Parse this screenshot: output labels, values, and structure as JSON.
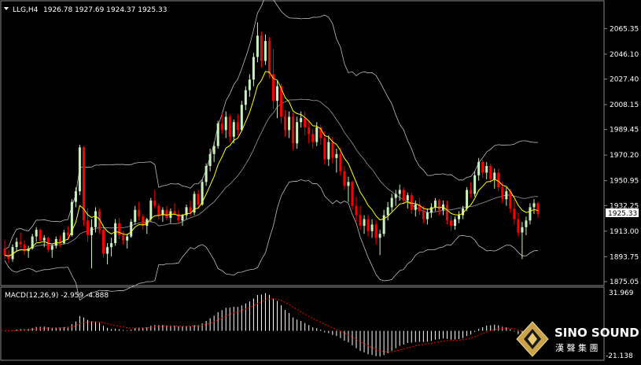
{
  "header": {
    "symbol": "LLG,H4",
    "ohlc": "1926.78 1927.69 1924.37 1925.33"
  },
  "macd_header": "MACD(12,26,9) -2.959 -4.888",
  "price_axis": {
    "ticks": [
      "2065.35",
      "2046.10",
      "2027.40",
      "2008.15",
      "1989.45",
      "1970.20",
      "1950.95",
      "1932.25",
      "1913.00",
      "1893.75",
      "1875.05"
    ],
    "current_price": "1925.33"
  },
  "macd_axis": {
    "top": "31.969",
    "bottom": "-21.138"
  },
  "logo": {
    "name": "SINO SOUND",
    "chinese": "漢 聲 集 團"
  },
  "colors": {
    "bull": "#c8f0c0",
    "bear": "#ff0000",
    "ma": "#ffff00",
    "bands": "#bdbdbd",
    "macd_hist": "#ffffff",
    "macd_signal": "#ff0000"
  },
  "chart_data": {
    "type": "candlestick",
    "ylim": [
      1875.05,
      2075
    ],
    "bars": [
      [
        1900,
        1906,
        1892,
        1895
      ],
      [
        1895,
        1899,
        1889,
        1892
      ],
      [
        1892,
        1903,
        1890,
        1901
      ],
      [
        1901,
        1908,
        1898,
        1905
      ],
      [
        1905,
        1912,
        1900,
        1903
      ],
      [
        1903,
        1906,
        1895,
        1898
      ],
      [
        1898,
        1902,
        1893,
        1900
      ],
      [
        1900,
        1911,
        1899,
        1909
      ],
      [
        1909,
        1916,
        1905,
        1914
      ],
      [
        1914,
        1915,
        1904,
        1906
      ],
      [
        1906,
        1910,
        1901,
        1908
      ],
      [
        1908,
        1909,
        1897,
        1899
      ],
      [
        1899,
        1903,
        1893,
        1902
      ],
      [
        1902,
        1909,
        1900,
        1907
      ],
      [
        1907,
        1910,
        1901,
        1904
      ],
      [
        1904,
        1914,
        1903,
        1912
      ],
      [
        1912,
        1917,
        1907,
        1910
      ],
      [
        1910,
        1937,
        1909,
        1935
      ],
      [
        1935,
        1946,
        1931,
        1943
      ],
      [
        1943,
        1978,
        1940,
        1976
      ],
      [
        1976,
        1977,
        1917,
        1921
      ],
      [
        1921,
        1930,
        1905,
        1910
      ],
      [
        1910,
        1922,
        1885,
        1916
      ],
      [
        1916,
        1931,
        1912,
        1928
      ],
      [
        1928,
        1930,
        1911,
        1914
      ],
      [
        1914,
        1918,
        1893,
        1896
      ],
      [
        1896,
        1904,
        1888,
        1901
      ],
      [
        1901,
        1908,
        1894,
        1904
      ],
      [
        1904,
        1922,
        1902,
        1919
      ],
      [
        1919,
        1923,
        1907,
        1910
      ],
      [
        1910,
        1913,
        1903,
        1906
      ],
      [
        1906,
        1911,
        1900,
        1909
      ],
      [
        1909,
        1922,
        1908,
        1920
      ],
      [
        1920,
        1932,
        1918,
        1929
      ],
      [
        1929,
        1935,
        1921,
        1924
      ],
      [
        1924,
        1926,
        1914,
        1917
      ],
      [
        1917,
        1923,
        1911,
        1922
      ],
      [
        1922,
        1938,
        1920,
        1936
      ],
      [
        1936,
        1944,
        1930,
        1932
      ],
      [
        1932,
        1934,
        1922,
        1925
      ],
      [
        1925,
        1931,
        1920,
        1929
      ],
      [
        1929,
        1932,
        1921,
        1923
      ],
      [
        1923,
        1930,
        1919,
        1928
      ],
      [
        1928,
        1934,
        1925,
        1926
      ],
      [
        1926,
        1929,
        1919,
        1921
      ],
      [
        1921,
        1926,
        1917,
        1925
      ],
      [
        1925,
        1933,
        1922,
        1931
      ],
      [
        1931,
        1936,
        1924,
        1927
      ],
      [
        1927,
        1943,
        1925,
        1941
      ],
      [
        1941,
        1944,
        1930,
        1933
      ],
      [
        1933,
        1952,
        1932,
        1950
      ],
      [
        1950,
        1964,
        1947,
        1962
      ],
      [
        1962,
        1975,
        1958,
        1971
      ],
      [
        1971,
        1980,
        1965,
        1977
      ],
      [
        1977,
        1996,
        1975,
        1994
      ],
      [
        1994,
        2002,
        1986,
        1989
      ],
      [
        1989,
        2003,
        1983,
        1999
      ],
      [
        1999,
        2001,
        1980,
        1984
      ],
      [
        1984,
        1997,
        1979,
        1995
      ],
      [
        1995,
        2001,
        1985,
        1989
      ],
      [
        1989,
        2011,
        1988,
        2008
      ],
      [
        2008,
        2022,
        2004,
        2019
      ],
      [
        2019,
        2031,
        2014,
        2027
      ],
      [
        2027,
        2047,
        2022,
        2044
      ],
      [
        2044,
        2070,
        2040,
        2060
      ],
      [
        2060,
        2063,
        2036,
        2041
      ],
      [
        2041,
        2061,
        2038,
        2056
      ],
      [
        2056,
        2059,
        2028,
        2031
      ],
      [
        2031,
        2050,
        2005,
        2011
      ],
      [
        2011,
        2026,
        1998,
        2022
      ],
      [
        2022,
        2024,
        1994,
        1999
      ],
      [
        1999,
        2004,
        1984,
        1989
      ],
      [
        1989,
        2003,
        1983,
        1999
      ],
      [
        1999,
        2002,
        1974,
        1979
      ],
      [
        1979,
        1999,
        1975,
        1995
      ],
      [
        1995,
        2003,
        1991,
        1998
      ],
      [
        1998,
        2003,
        1985,
        1991
      ],
      [
        1991,
        1996,
        1979,
        1986
      ],
      [
        1986,
        1990,
        1975,
        1980
      ],
      [
        1980,
        1995,
        1977,
        1991
      ],
      [
        1991,
        1993,
        1978,
        1983
      ],
      [
        1983,
        1988,
        1963,
        1967
      ],
      [
        1967,
        1985,
        1962,
        1980
      ],
      [
        1980,
        1984,
        1964,
        1968
      ],
      [
        1968,
        1975,
        1957,
        1971
      ],
      [
        1971,
        1976,
        1955,
        1958
      ],
      [
        1958,
        1962,
        1944,
        1947
      ],
      [
        1947,
        1954,
        1935,
        1950
      ],
      [
        1950,
        1951,
        1929,
        1932
      ],
      [
        1932,
        1939,
        1920,
        1925
      ],
      [
        1925,
        1932,
        1914,
        1917
      ],
      [
        1917,
        1925,
        1911,
        1922
      ],
      [
        1922,
        1925,
        1909,
        1913
      ],
      [
        1913,
        1922,
        1908,
        1918
      ],
      [
        1918,
        1921,
        1903,
        1908
      ],
      [
        1908,
        1914,
        1895,
        1911
      ],
      [
        1911,
        1929,
        1909,
        1925
      ],
      [
        1925,
        1935,
        1921,
        1931
      ],
      [
        1931,
        1941,
        1928,
        1938
      ],
      [
        1938,
        1944,
        1932,
        1941
      ],
      [
        1941,
        1948,
        1936,
        1944
      ],
      [
        1944,
        1946,
        1933,
        1936
      ],
      [
        1936,
        1942,
        1930,
        1940
      ],
      [
        1940,
        1942,
        1926,
        1929
      ],
      [
        1929,
        1936,
        1924,
        1933
      ],
      [
        1933,
        1938,
        1925,
        1928
      ],
      [
        1928,
        1932,
        1919,
        1922
      ],
      [
        1922,
        1930,
        1918,
        1927
      ],
      [
        1927,
        1934,
        1923,
        1931
      ],
      [
        1931,
        1938,
        1928,
        1936
      ],
      [
        1936,
        1937,
        1925,
        1929
      ],
      [
        1929,
        1936,
        1925,
        1933
      ],
      [
        1933,
        1936,
        1918,
        1921
      ],
      [
        1921,
        1925,
        1913,
        1917
      ],
      [
        1917,
        1924,
        1914,
        1922
      ],
      [
        1922,
        1928,
        1919,
        1925
      ],
      [
        1925,
        1932,
        1922,
        1930
      ],
      [
        1930,
        1946,
        1928,
        1944
      ],
      [
        1944,
        1950,
        1938,
        1941
      ],
      [
        1941,
        1958,
        1939,
        1955
      ],
      [
        1955,
        1968,
        1951,
        1965
      ],
      [
        1965,
        1967,
        1953,
        1957
      ],
      [
        1957,
        1965,
        1952,
        1962
      ],
      [
        1962,
        1964,
        1949,
        1952
      ],
      [
        1952,
        1960,
        1945,
        1957
      ],
      [
        1957,
        1960,
        1943,
        1946
      ],
      [
        1946,
        1950,
        1934,
        1937
      ],
      [
        1937,
        1946,
        1932,
        1943
      ],
      [
        1943,
        1945,
        1927,
        1930
      ],
      [
        1930,
        1937,
        1918,
        1922
      ],
      [
        1922,
        1927,
        1909,
        1912
      ],
      [
        1912,
        1920,
        1892,
        1916
      ],
      [
        1916,
        1924,
        1910,
        1921
      ],
      [
        1921,
        1934,
        1918,
        1931
      ],
      [
        1931,
        1937,
        1926,
        1934
      ],
      [
        1934,
        1935,
        1923,
        1926
      ]
    ]
  }
}
